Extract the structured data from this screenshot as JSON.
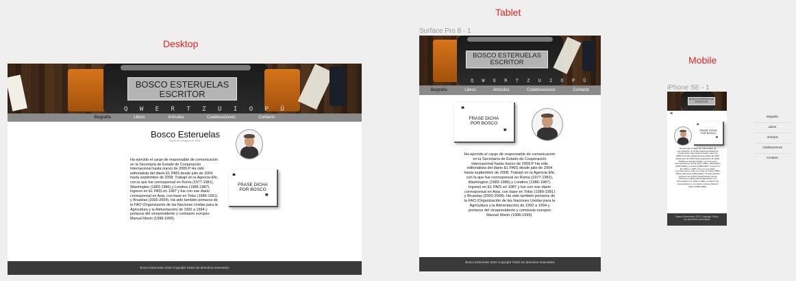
{
  "labels": {
    "desktop": "Desktop",
    "tablet": "Tablet",
    "mobile": "Mobile",
    "tablet_frame": "Surface Pro 8 - 1",
    "mobile_frame": "iPhone SE - 1"
  },
  "site": {
    "title_line1": "BOSCO ESTERUELAS",
    "title_line2": "ESCRITOR",
    "keys": "Q W E R T Z U I O P Ü",
    "nav": [
      "Biografía",
      "Libros",
      "Artículos",
      "Colaboraciones",
      "Contacto"
    ],
    "name": "Bosco Esteruelas",
    "subtitle": "Nacido en Zaragoza en 1955",
    "quote": "FRASE DICHA POR BOSCO",
    "quote_line1": "FRASE DICHA",
    "quote_line2": "POR BOSCO",
    "open_quote": "❝",
    "close_quote": "❞",
    "bio": "Ha ejercido el cargo de  responsable de comunicación en la Secretaría de Estado de Cooperación Internacional hasta marzo de 2009.P Ha sido editorialista del diario EL PAÍS desde julio de 2004 hasta septiembre de 2008. Trabajó en la Agencia Efe, con la que fue corresponsal en Roma (1977-1981), Washington (1983-1986) y Londres (1986-1987). Ingresó en EL PAÍS en 1987 y fue con ese diario corresponsal en Asia, con base en Tokio (1989-1991) y Bruselas (2000-2004). Ha sido también portavoz de la FAO (Organización de las Naciones Unidas para la Agricultura y la Alimentación) de 1992 a 1994 y portavoz del vicepresidente y comisario europeo Manuel Marín (1998-1999).",
    "footer": "Bosco Esteruelas 2022 Copyright Todos los derechos reservados",
    "menu_icon": "hamburger-icon"
  },
  "colors": {
    "label_red": "#e8201f",
    "nav_gray": "#8a8a8a",
    "footer_dark": "#3a3a3a"
  }
}
